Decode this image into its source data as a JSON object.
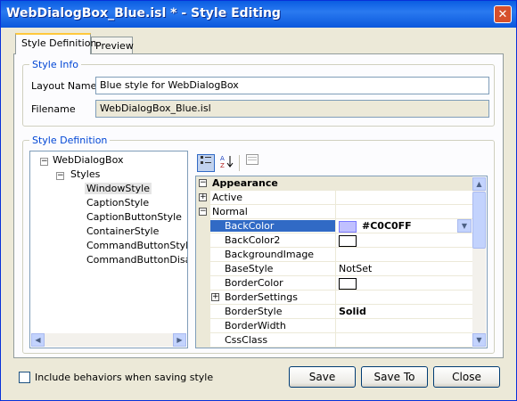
{
  "window": {
    "title": "WebDialogBox_Blue.isl * - Style Editing",
    "close_glyph": "✕"
  },
  "tabs": [
    {
      "label": "Style Definition",
      "active": true
    },
    {
      "label": "Preview",
      "active": false
    }
  ],
  "style_info": {
    "group_label": "Style Info",
    "layout_name_label": "Layout Name",
    "layout_name_value": "Blue style for WebDialogBox",
    "filename_label": "Filename",
    "filename_value": "WebDialogBox_Blue.isl"
  },
  "style_definition": {
    "group_label": "Style Definition",
    "tree": {
      "root": "WebDialogBox",
      "folder": "Styles",
      "items": [
        "WindowStyle",
        "CaptionStyle",
        "CaptionButtonStyle",
        "ContainerStyle",
        "CommandButtonStyle",
        "CommandButtonDisable"
      ],
      "selected": "WindowStyle"
    }
  },
  "property_grid": {
    "category": "Appearance",
    "rows": [
      {
        "name": "Active",
        "value": "",
        "expand": "+"
      },
      {
        "name": "Normal",
        "value": "",
        "expand": "−"
      },
      {
        "name": "BackColor",
        "value": "#C0C0FF",
        "swatch": "#c0c0ff",
        "selected": true
      },
      {
        "name": "BackColor2",
        "value": "",
        "swatch": "#ffffff"
      },
      {
        "name": "BackgroundImage",
        "value": ""
      },
      {
        "name": "BaseStyle",
        "value": "NotSet"
      },
      {
        "name": "BorderColor",
        "value": "",
        "swatch": "#ffffff"
      },
      {
        "name": "BorderSettings",
        "value": "",
        "expand": "+"
      },
      {
        "name": "BorderStyle",
        "value": "Solid"
      },
      {
        "name": "BorderWidth",
        "value": ""
      },
      {
        "name": "CssClass",
        "value": ""
      }
    ]
  },
  "footer": {
    "checkbox_label": "Include behaviors when saving style",
    "save_label": "Save",
    "save_to_label": "Save To",
    "close_label": "Close"
  },
  "colors": {
    "titlebar": "#0a5de2",
    "selection": "#316ac5",
    "group_label": "#0046d5"
  }
}
